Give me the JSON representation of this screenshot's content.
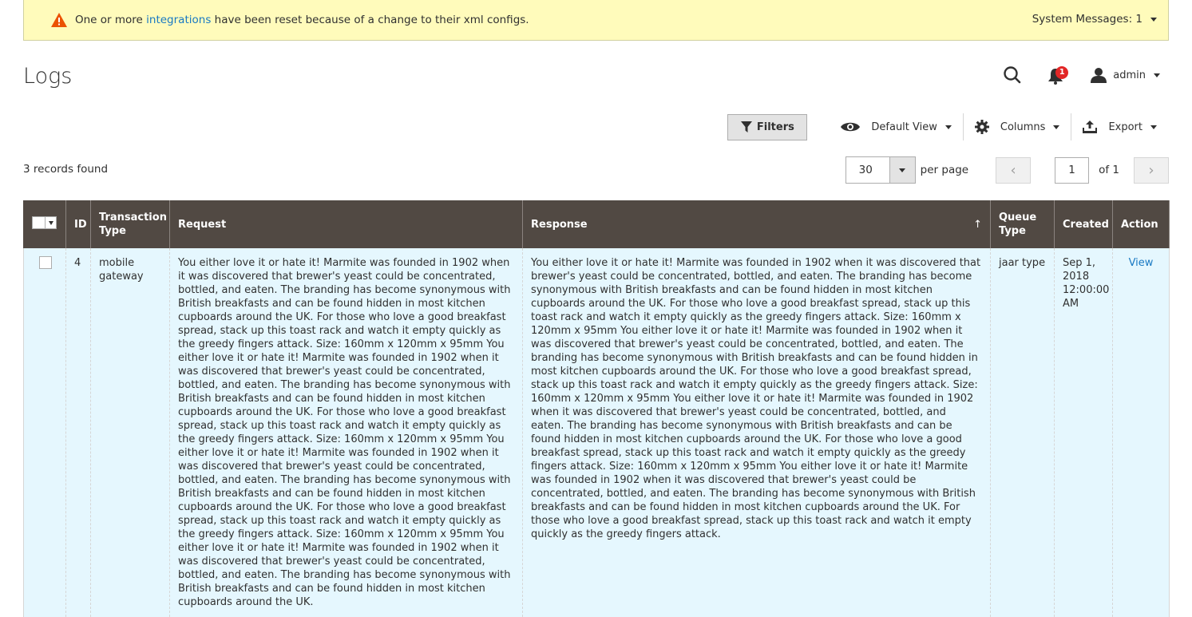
{
  "system_message": {
    "prefix": "One or more ",
    "link": "integrations",
    "suffix": " have been reset because of a change to their xml configs.",
    "count_label": "System Messages: 1"
  },
  "header": {
    "title": "Logs",
    "notifications_count": "1",
    "user": "admin"
  },
  "toolbar": {
    "filters": "Filters",
    "view": "Default View",
    "columns": "Columns",
    "export": "Export"
  },
  "records_found": "3 records found",
  "pager": {
    "per_page_value": "30",
    "per_page_label": "per page",
    "current_page": "1",
    "of_label": "of 1"
  },
  "grid": {
    "columns": [
      "ID",
      "Transaction Type",
      "Request",
      "Response",
      "Queue Type",
      "Created",
      "Action"
    ],
    "rows": [
      {
        "id": "4",
        "transaction_type": "mobile gateway",
        "request": "You either love it or hate it! Marmite was founded in 1902 when it was discovered that brewer's yeast could be concentrated, bottled, and eaten. The branding has become synonymous with British breakfasts and can be found hidden in most kitchen cupboards around the UK. For those who love a good breakfast spread, stack up this toast rack and watch it empty quickly as the greedy fingers attack. Size: 160mm x 120mm x 95mm You either love it or hate it! Marmite was founded in 1902 when it was discovered that brewer's yeast could be concentrated, bottled, and eaten. The branding has become synonymous with British breakfasts and can be found hidden in most kitchen cupboards around the UK. For those who love a good breakfast spread, stack up this toast rack and watch it empty quickly as the greedy fingers attack. Size: 160mm x 120mm x 95mm You either love it or hate it! Marmite was founded in 1902 when it was discovered that brewer's yeast could be concentrated, bottled, and eaten. The branding has become synonymous with British breakfasts and can be found hidden in most kitchen cupboards around the UK. For those who love a good breakfast spread, stack up this toast rack and watch it empty quickly as the greedy fingers attack. Size: 160mm x 120mm x 95mm You either love it or hate it! Marmite was founded in 1902 when it was discovered that brewer's yeast could be concentrated, bottled, and eaten. The branding has become synonymous with British breakfasts and can be found hidden in most kitchen cupboards around the UK.",
        "response": "You either love it or hate it! Marmite was founded in 1902 when it was discovered that brewer's yeast could be concentrated, bottled, and eaten. The branding has become synonymous with British breakfasts and can be found hidden in most kitchen cupboards around the UK. For those who love a good breakfast spread, stack up this toast rack and watch it empty quickly as the greedy fingers attack. Size: 160mm x 120mm x 95mm You either love it or hate it! Marmite was founded in 1902 when it was discovered that brewer's yeast could be concentrated, bottled, and eaten. The branding has become synonymous with British breakfasts and can be found hidden in most kitchen cupboards around the UK. For those who love a good breakfast spread, stack up this toast rack and watch it empty quickly as the greedy fingers attack. Size: 160mm x 120mm x 95mm You either love it or hate it! Marmite was founded in 1902 when it was discovered that brewer's yeast could be concentrated, bottled, and eaten. The branding has become synonymous with British breakfasts and can be found hidden in most kitchen cupboards around the UK. For those who love a good breakfast spread, stack up this toast rack and watch it empty quickly as the greedy fingers attack. Size: 160mm x 120mm x 95mm You either love it or hate it! Marmite was founded in 1902 when it was discovered that brewer's yeast could be concentrated, bottled, and eaten. The branding has become synonymous with British breakfasts and can be found hidden in most kitchen cupboards around the UK. For those who love a good breakfast spread, stack up this toast rack and watch it empty quickly as the greedy fingers attack.",
        "queue_type": "jaar type",
        "created": "Sep 1, 2018 12:00:00 AM",
        "action": "View"
      }
    ]
  }
}
